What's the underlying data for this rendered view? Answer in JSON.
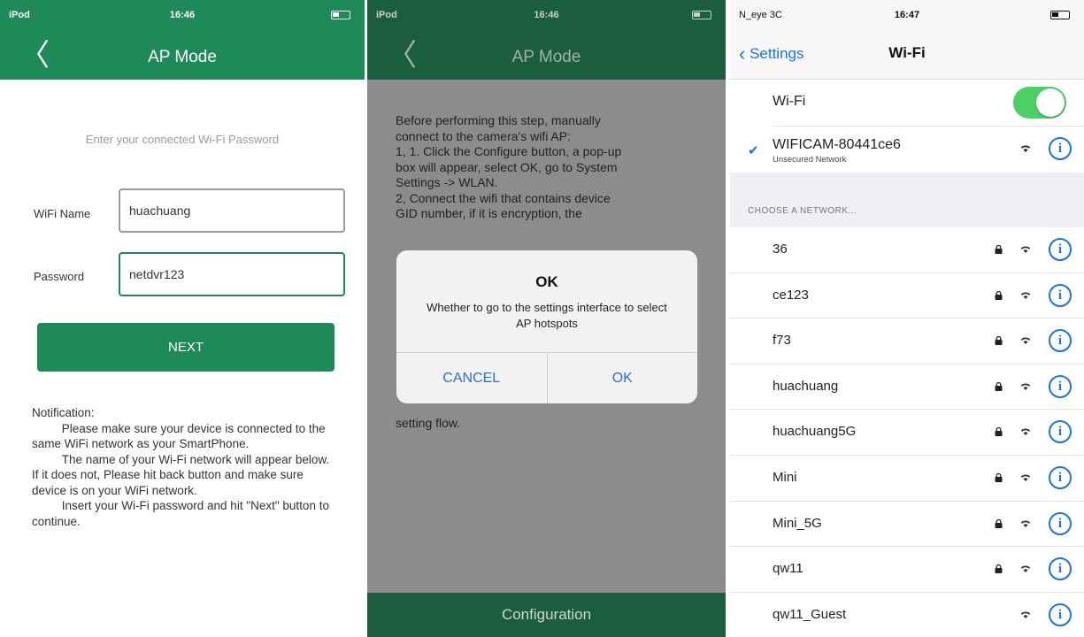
{
  "panel1": {
    "status": {
      "left": "iPod",
      "time": "16:46"
    },
    "nav": {
      "back": "〈",
      "title": "AP Mode"
    },
    "prompt": "Enter your connected Wi-Fi Password",
    "wifi_name_label": "WiFi Name",
    "wifi_name_value": "huachuang",
    "password_label": "Password",
    "password_value": "netdvr123",
    "next_label": "NEXT",
    "notification": {
      "heading": "Notification:",
      "paragraphs": [
        "Please make sure your device is connected to the same WiFi network as your SmartPhone.",
        "The name of your Wi-Fi network will appear below. If it does not, Please hit back button and make sure device is on your WiFi network.",
        "Insert your Wi-Fi password and hit \"Next\" button to continue."
      ]
    }
  },
  "panel2": {
    "status": {
      "left": "iPod",
      "time": "16:46"
    },
    "nav": {
      "back": "〈",
      "title": "AP Mode"
    },
    "instructions": [
      "Before performing this step, manually",
      "connect to the camera's wifi AP:",
      "1, 1. Click the Configure button, a pop-up",
      "box will appear, select OK, go to System",
      "Settings -> WLAN.",
      "2, Connect the wifi that contains device",
      "GID number, if it is encryption, the"
    ],
    "instructions_tail": "setting flow.",
    "dialog": {
      "title": "OK",
      "message": "Whether to go to the settings interface to select AP hotspots",
      "cancel": "CANCEL",
      "ok": "OK"
    },
    "config_label": "Configuration"
  },
  "panel3": {
    "status": {
      "left": "N_eye 3C",
      "time": "16:47"
    },
    "back_label": "Settings",
    "title": "Wi-Fi",
    "wifi_label": "Wi-Fi",
    "connected": {
      "name": "WIFICAM-80441ce6",
      "sub": "Unsecured Network"
    },
    "section_header": "CHOOSE A NETWORK...",
    "networks": [
      {
        "name": "36",
        "locked": true
      },
      {
        "name": "ce123",
        "locked": true
      },
      {
        "name": "f73",
        "locked": true
      },
      {
        "name": "huachuang",
        "locked": true
      },
      {
        "name": "huachuang5G",
        "locked": true
      },
      {
        "name": "Mini",
        "locked": true
      },
      {
        "name": "Mini_5G",
        "locked": true
      },
      {
        "name": "qw11",
        "locked": true
      },
      {
        "name": "qw11_Guest",
        "locked": false
      }
    ],
    "info_glyph": "i",
    "accent": "#1a73e8",
    "toggle_color": "#4bd063"
  },
  "brand_green": "#1e8a57"
}
